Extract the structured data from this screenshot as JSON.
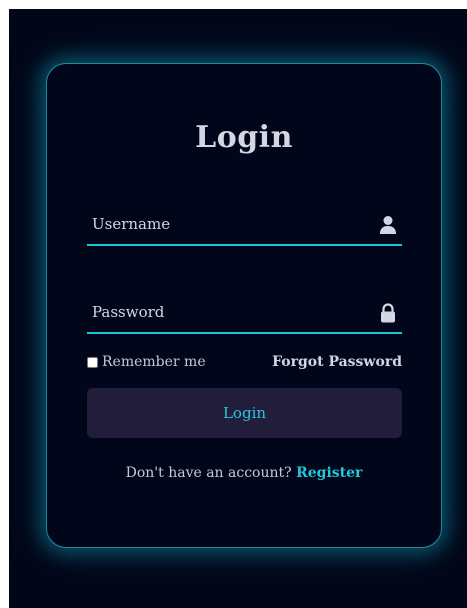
{
  "form": {
    "title": "Login",
    "username": {
      "label": "Username",
      "icon": "user-icon"
    },
    "password": {
      "label": "Password",
      "icon": "lock-icon"
    },
    "remember_label": "Remember me",
    "remember_checked": false,
    "forgot_label": "Forgot Password",
    "login_label": "Login",
    "register_prompt": "Don't have an account?",
    "register_label": "Register"
  },
  "colors": {
    "background": "#020617",
    "accent": "#22c8dc",
    "underline": "#18c6d9",
    "button": "#221d3a",
    "text": "#d4d6e4",
    "glow": "#1f8a9a"
  }
}
